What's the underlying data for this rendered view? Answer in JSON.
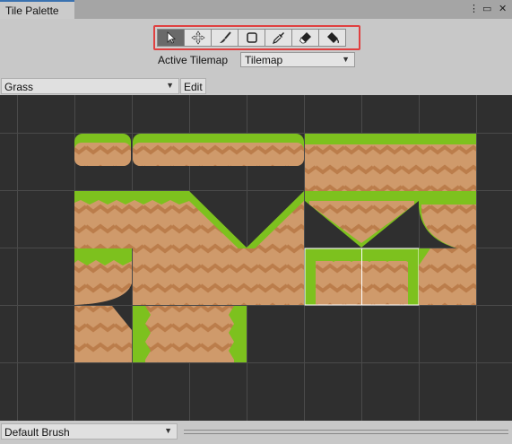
{
  "window": {
    "tab_title": "Tile Palette",
    "menu_icon": "kebab-menu-icon",
    "maximize_icon": "maximize-icon",
    "close_icon": "close-icon"
  },
  "toolbar": {
    "tools": [
      {
        "name": "select-tool",
        "icon": "select-arrow-icon",
        "active": true
      },
      {
        "name": "move-tool",
        "icon": "move-arrows-icon",
        "active": false
      },
      {
        "name": "paint-tool",
        "icon": "paintbrush-icon",
        "active": false
      },
      {
        "name": "box-fill-tool",
        "icon": "box-fill-icon",
        "active": false
      },
      {
        "name": "pick-tool",
        "icon": "eyedropper-icon",
        "active": false
      },
      {
        "name": "erase-tool",
        "icon": "eraser-icon",
        "active": false
      },
      {
        "name": "fill-tool",
        "icon": "bucket-fill-icon",
        "active": false
      }
    ],
    "highlight_color": "#e04040"
  },
  "active_tilemap": {
    "label": "Active Tilemap",
    "value": "Tilemap"
  },
  "palette": {
    "selected": "Grass",
    "edit_label": "Edit"
  },
  "colors": {
    "grass": "#7dc11e",
    "dirt": "#cf9a6b",
    "dirt_zigzag": "#bb7d4b",
    "grid_bg": "#2f2f2f"
  },
  "brush": {
    "selected": "Default Brush"
  }
}
